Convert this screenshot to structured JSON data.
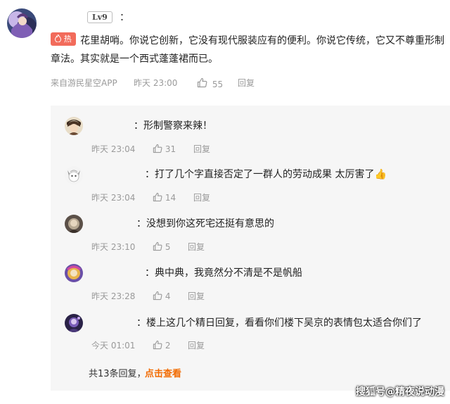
{
  "main_comment": {
    "level": "Lv9",
    "colon": "：",
    "hot_badge": "热",
    "text": "花里胡哨。你说它创新，它没有现代服装应有的便利。你说它传统，它又不尊重形制章法。其实就是一个西式蓬蓬裙而已。",
    "source": "来自游民星空APP",
    "time": "昨天 23:00",
    "likes": "55",
    "reply_label": "回复"
  },
  "replies": [
    {
      "colon": "：",
      "text": "形制警察来辣！",
      "time": "昨天 23:04",
      "likes": "31",
      "reply_label": "回复"
    },
    {
      "colon": "：",
      "text": "打了几个字直接否定了一群人的劳动成果 太厉害了👍",
      "time": "昨天 23:04",
      "likes": "14",
      "reply_label": "回复"
    },
    {
      "colon": "：",
      "text": "没想到你这死宅还挺有意思的",
      "time": "昨天 23:10",
      "likes": "5",
      "reply_label": "回复"
    },
    {
      "colon": "：",
      "text": "典中典，我竟然分不清是不是帆船",
      "time": "昨天 23:28",
      "likes": "4",
      "reply_label": "回复"
    },
    {
      "colon": "：",
      "text": "楼上这几个精日回复，看看你们楼下吴京的表情包太适合你们了",
      "time": "今天 01:01",
      "likes": "2",
      "reply_label": "回复"
    }
  ],
  "footer": {
    "count": "共13条回复，",
    "view_link": "点击查看"
  },
  "watermark": "搜狐号@精夜说动漫",
  "colors": {
    "hot": "#f26b5b",
    "link": "#f26b00",
    "panel_bg": "#f6f6f6",
    "meta": "#9a9a9a"
  },
  "icons": {
    "like": "thumbs-up-outline"
  }
}
